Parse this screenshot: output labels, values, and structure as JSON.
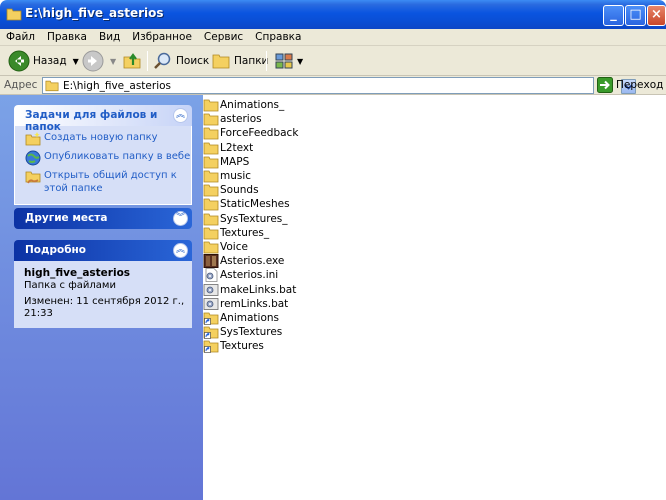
{
  "window": {
    "title": "E:\\high_five_asterios"
  },
  "menu": [
    "Файл",
    "Правка",
    "Вид",
    "Избранное",
    "Сервис",
    "Справка"
  ],
  "toolbar": {
    "back": "Назад",
    "search": "Поиск",
    "folders": "Папки"
  },
  "address": {
    "label": "Адрес",
    "value": "E:\\high_five_asterios",
    "go": "Переход"
  },
  "tasks": {
    "title": "Задачи для файлов и папок",
    "items": [
      "Создать новую папку",
      "Опубликовать папку в вебе",
      "Открыть общий доступ к этой папке"
    ]
  },
  "other_places": {
    "title": "Другие места"
  },
  "details": {
    "title": "Подробно",
    "name": "high_five_asterios",
    "type": "Папка с файлами",
    "modified": "Изменен: 11 сентября 2012 г., 21:33"
  },
  "files": [
    {
      "name": "Animations_",
      "kind": "folder-icon"
    },
    {
      "name": "asterios",
      "kind": "folder-icon"
    },
    {
      "name": "ForceFeedback",
      "kind": "folder-icon"
    },
    {
      "name": "L2text",
      "kind": "folder-icon"
    },
    {
      "name": "MAPS",
      "kind": "folder-icon"
    },
    {
      "name": "music",
      "kind": "folder-icon"
    },
    {
      "name": "Sounds",
      "kind": "folder-icon"
    },
    {
      "name": "StaticMeshes",
      "kind": "folder-icon"
    },
    {
      "name": "SysTextures_",
      "kind": "folder-icon"
    },
    {
      "name": "Textures_",
      "kind": "folder-icon"
    },
    {
      "name": "Voice",
      "kind": "folder-icon"
    },
    {
      "name": "Asterios.exe",
      "kind": "exe-icon"
    },
    {
      "name": "Asterios.ini",
      "kind": "ini-icon"
    },
    {
      "name": "makeLinks.bat",
      "kind": "bat-icon"
    },
    {
      "name": "remLinks.bat",
      "kind": "bat-icon"
    },
    {
      "name": "Animations",
      "kind": "folder-shortcut-icon"
    },
    {
      "name": "SysTextures",
      "kind": "folder-shortcut-icon"
    },
    {
      "name": "Textures",
      "kind": "folder-shortcut-icon"
    }
  ]
}
